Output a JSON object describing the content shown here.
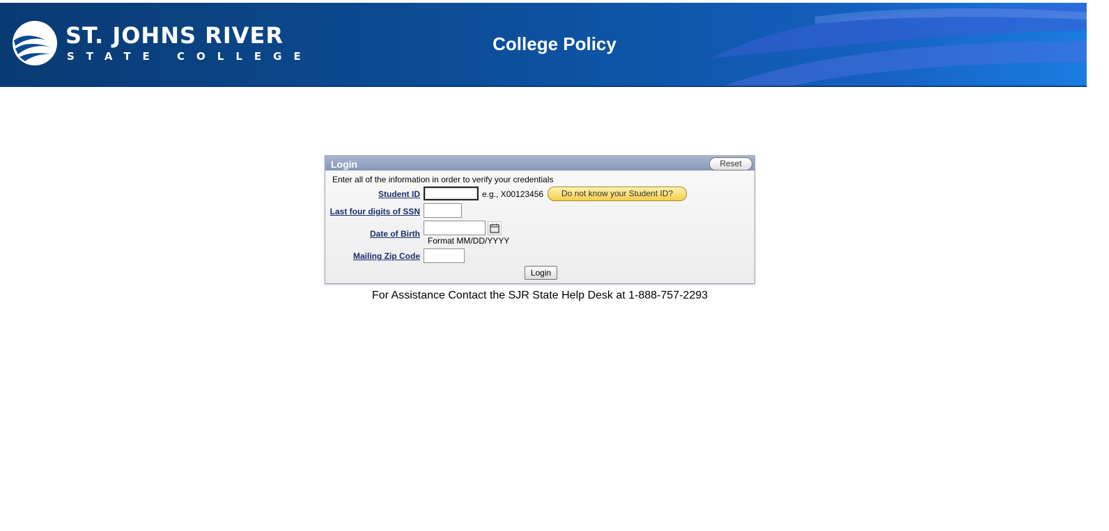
{
  "header": {
    "logo_line1": "ST. JOHNS RIVER",
    "logo_line2": "STATE COLLEGE",
    "title": "College Policy"
  },
  "login": {
    "title": "Login",
    "reset_label": "Reset",
    "instructions": "Enter all of the information in order to verify your credentials",
    "student_id": {
      "label": "Student ID",
      "value": "",
      "example": "e.g., X00123456",
      "lookup_label": "Do not know your Student ID?"
    },
    "ssn": {
      "label": "Last four digits of SSN",
      "value": ""
    },
    "dob": {
      "label": "Date of Birth",
      "value": "",
      "format_hint": "Format MM/DD/YYYY",
      "calendar_icon": "calendar-icon"
    },
    "zip": {
      "label": "Mailing Zip Code",
      "value": ""
    },
    "submit_label": "Login"
  },
  "footer": {
    "assistance": "For Assistance Contact the SJR State Help Desk at 1-888-757-2293"
  },
  "colors": {
    "header_blue": "#0b4a90",
    "label_navy": "#1a2f6a",
    "lookup_button": "#f6cf4a"
  }
}
